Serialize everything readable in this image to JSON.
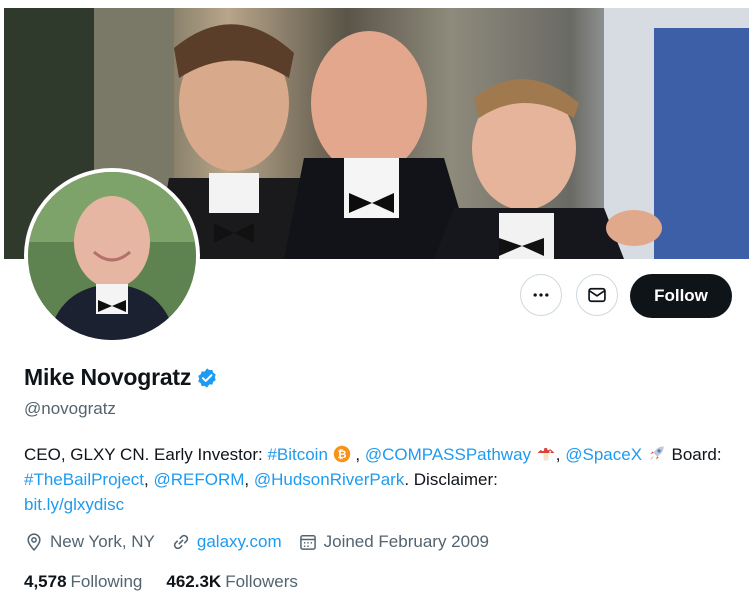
{
  "profile": {
    "name": "Mike Novogratz",
    "handle": "@novogratz",
    "verified": true,
    "accent_color": "#1d9bf0"
  },
  "actions": {
    "more_icon": "more-horizontal-icon",
    "message_icon": "envelope-icon",
    "follow_label": "Follow"
  },
  "bio": {
    "text_1": "CEO, GLXY CN. Early Investor: ",
    "tag_bitcoin": "#Bitcoin",
    "text_2": " , ",
    "mention_compass": "@COMPASSPathway",
    "text_3": ", ",
    "mention_spacex": "@SpaceX",
    "text_4": " Board: ",
    "tag_bail": "#TheBailProject",
    "text_5": ", ",
    "mention_reform": "@REFORM",
    "text_6": ", ",
    "mention_hudson": "@HudsonRiverPark",
    "text_7": ". Disclaimer: ",
    "link_disc": "bit.ly/glxydisc"
  },
  "meta": {
    "location": "New York, NY",
    "website": "galaxy.com",
    "joined": "Joined February 2009"
  },
  "stats": {
    "following_count": "4,578",
    "following_label": "Following",
    "followers_count": "462.3K",
    "followers_label": "Followers"
  }
}
